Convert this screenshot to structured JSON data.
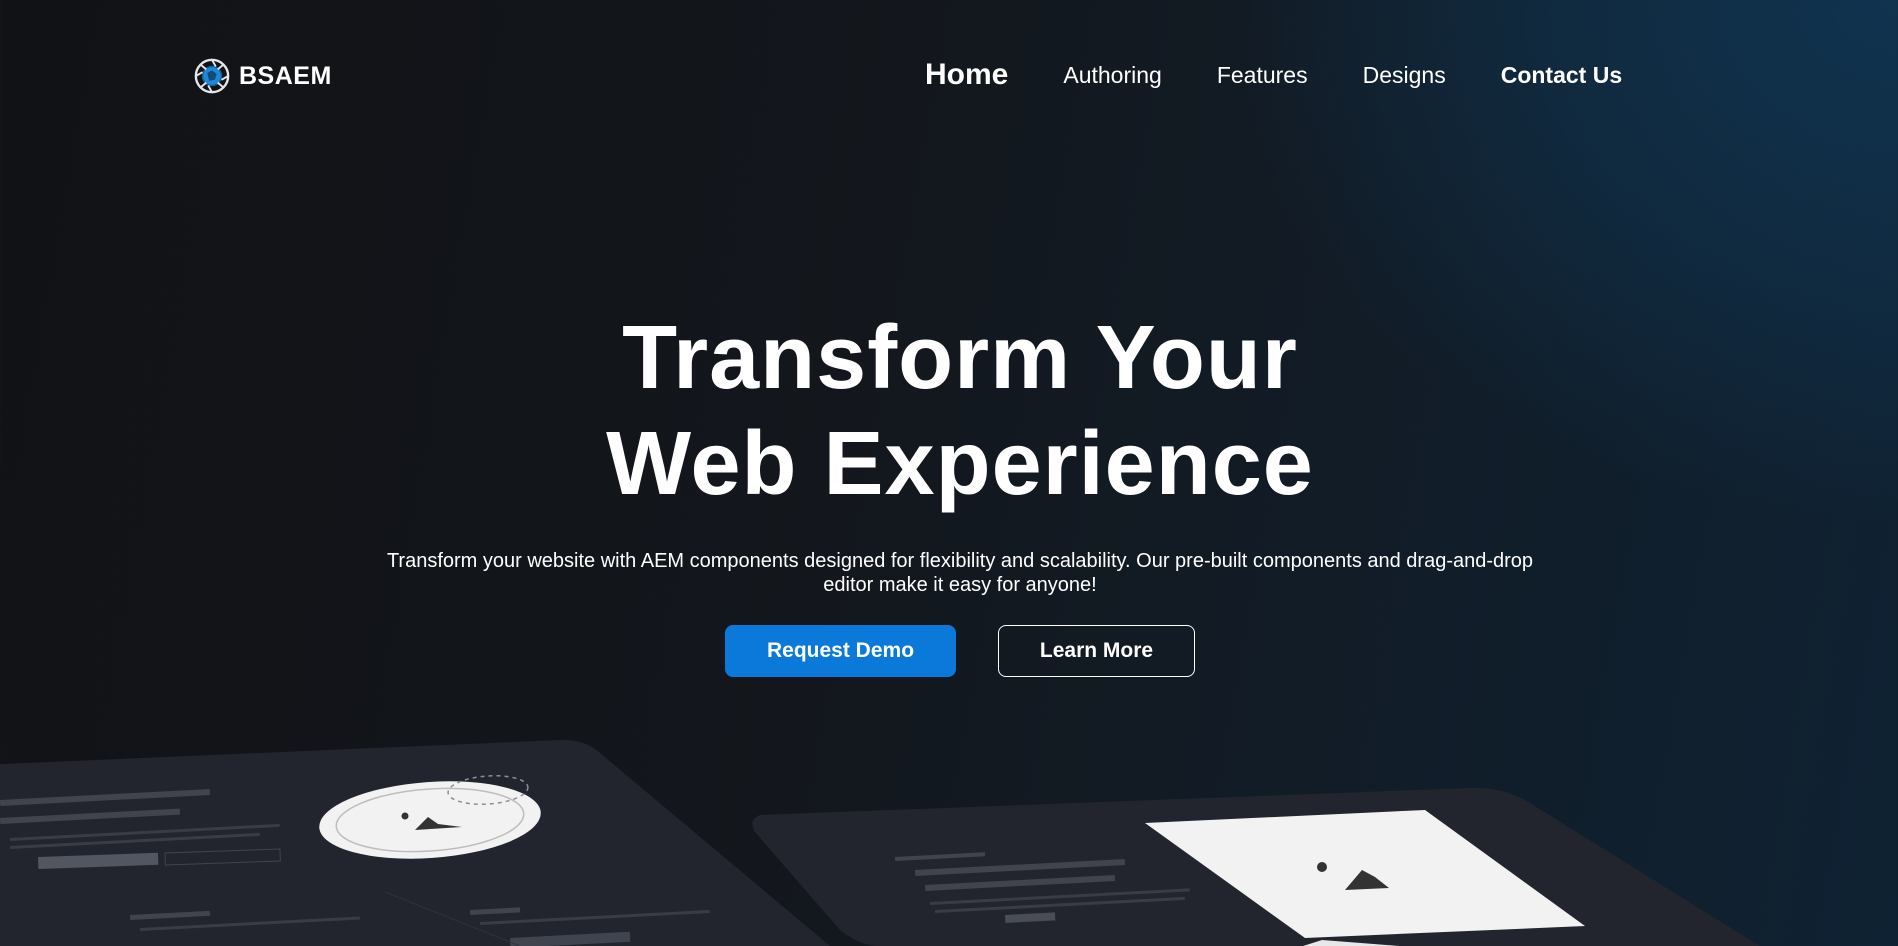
{
  "brand": {
    "name": "BSAEM",
    "logo_icon": "aperture-globe-icon"
  },
  "nav": {
    "items": [
      {
        "label": "Home",
        "active": true
      },
      {
        "label": "Authoring"
      },
      {
        "label": "Features"
      },
      {
        "label": "Designs"
      },
      {
        "label": "Contact Us"
      }
    ]
  },
  "hero": {
    "title_line1": "Transform Your",
    "title_line2": "Web Experience",
    "description": "Transform your website with AEM components designed for flexibility and scalability. Our pre-built components and drag-and-drop editor make it easy for anyone!",
    "primary_cta": "Request Demo",
    "secondary_cta": "Learn More"
  },
  "colors": {
    "accent": "#0b79d9",
    "background_dark": "#121316",
    "background_blue": "#10334f",
    "panel": "#22252d"
  }
}
